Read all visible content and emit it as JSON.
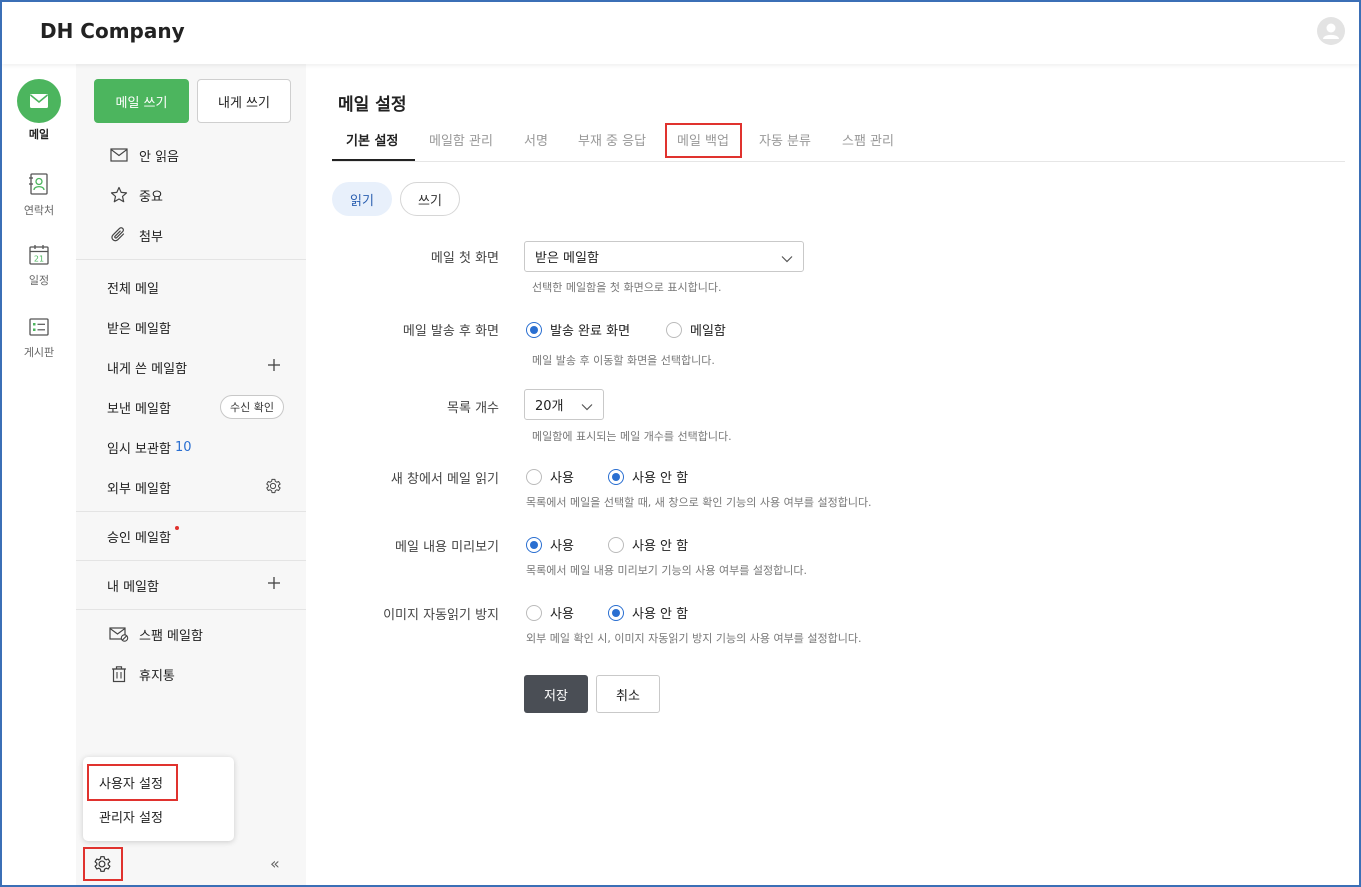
{
  "app": {
    "title": "DH Company"
  },
  "rail": {
    "items": [
      {
        "label": "메일",
        "icon": "mail-icon",
        "active": true
      },
      {
        "label": "연락처",
        "icon": "contacts-icon"
      },
      {
        "label": "일정",
        "icon": "calendar-icon",
        "day": "21"
      },
      {
        "label": "게시판",
        "icon": "board-icon"
      }
    ]
  },
  "sidebar": {
    "compose": "메일 쓰기",
    "write_self": "내게 쓰기",
    "quick": [
      {
        "label": "안 읽음",
        "icon": "envelope-icon"
      },
      {
        "label": "중요",
        "icon": "star-icon"
      },
      {
        "label": "첨부",
        "icon": "paperclip-icon"
      }
    ],
    "folders": [
      {
        "label": "전체 메일"
      },
      {
        "label": "받은 메일함"
      },
      {
        "label": "내게 쓴 메일함"
      },
      {
        "label": "보낸 메일함",
        "pill": "수신 확인"
      },
      {
        "label": "임시 보관함",
        "count": "10"
      },
      {
        "label": "외부 메일함"
      }
    ],
    "approval": "승인 메일함",
    "my_mailbox": "내 메일함",
    "spam": "스팸 메일함",
    "trash": "휴지통",
    "popup": {
      "user_settings": "사용자 설정",
      "admin_settings": "관리자 설정"
    },
    "collapse_glyph": "«"
  },
  "main": {
    "title": "메일 설정",
    "tabs": [
      {
        "label": "기본 설정",
        "active": true
      },
      {
        "label": "메일함 관리"
      },
      {
        "label": "서명"
      },
      {
        "label": "부재 중 응답"
      },
      {
        "label": "메일 백업",
        "highlighted": true
      },
      {
        "label": "자동 분류"
      },
      {
        "label": "스팸 관리"
      }
    ],
    "segments": {
      "read": "읽기",
      "write": "쓰기",
      "selected": "read"
    },
    "settings": {
      "first_screen": {
        "label": "메일 첫 화면",
        "value": "받은 메일함",
        "help": "선택한 메일함을 첫 화면으로 표시합니다."
      },
      "after_send": {
        "label": "메일 발송 후 화면",
        "options": [
          "발송 완료 화면",
          "메일함"
        ],
        "selected": 0,
        "help": "메일 발송 후 이동할 화면을 선택합니다."
      },
      "list_count": {
        "label": "목록 개수",
        "value": "20개",
        "help": "메일함에 표시되는 메일 개수를 선택합니다."
      },
      "new_window": {
        "label": "새 창에서 메일 읽기",
        "options": [
          "사용",
          "사용 안 함"
        ],
        "selected": 1,
        "help": "목록에서 메일을 선택할 때, 새 창으로 확인 기능의 사용 여부를 설정합니다."
      },
      "preview": {
        "label": "메일 내용 미리보기",
        "options": [
          "사용",
          "사용 안 함"
        ],
        "selected": 0,
        "help": "목록에서 메일 내용 미리보기 기능의 사용 여부를 설정합니다."
      },
      "block_images": {
        "label": "이미지 자동읽기 방지",
        "options": [
          "사용",
          "사용 안 함"
        ],
        "selected": 1,
        "help": "외부 메일 확인 시, 이미지 자동읽기 방지 기능의 사용 여부를 설정합니다."
      }
    },
    "buttons": {
      "save": "저장",
      "cancel": "취소"
    }
  },
  "colors": {
    "brand_green": "#4cb55e",
    "accent_blue": "#2a6fd1",
    "highlight_red": "#e0322e",
    "frame_blue": "#3b6fb6"
  }
}
